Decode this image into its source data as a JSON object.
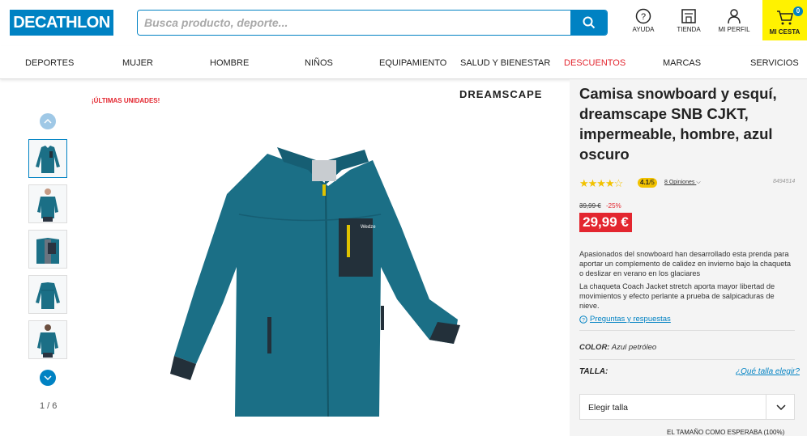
{
  "header": {
    "logo": "DECATHLON",
    "search_placeholder": "Busca producto, deporte...",
    "help": "AYUDA",
    "store": "TIENDA",
    "profile": "MI PERFIL",
    "cart": "MI CESTA",
    "cart_count": "0"
  },
  "nav": [
    {
      "label": "DEPORTES"
    },
    {
      "label": "MUJER"
    },
    {
      "label": "HOMBRE"
    },
    {
      "label": "NIÑOS"
    },
    {
      "label": "EQUIPAMIENTO"
    },
    {
      "label": "SALUD Y BIENESTAR"
    },
    {
      "label": "DESCUENTOS"
    },
    {
      "label": "MARCAS"
    },
    {
      "label": "SERVICIOS"
    }
  ],
  "gallery": {
    "pager": "1 / 6",
    "badge": "¡ÚLTIMAS UNIDADES!",
    "brand": "DREAMSCAPE"
  },
  "product": {
    "title": "Camisa snowboard y esquí, dreamscape SNB CJKT, impermeable, hombre, azul oscuro",
    "stars": "★★★★☆",
    "rating": "4.1",
    "rating_max": "/5",
    "reviews": "8 Opiniones",
    "sku": "8494514",
    "old_price": "39,99 €",
    "discount": "-25%",
    "price": "29,99 €",
    "desc1": "Apasionados del snowboard han desarrollado esta prenda para aportar un complemento de calidez en invierno bajo la chaqueta o deslizar en verano en los glaciares",
    "desc2": "La chaqueta Coach Jacket stretch aporta mayor libertad de movimientos y efecto perlante a prueba de salpicaduras de nieve.",
    "qa": "Preguntas y respuestas",
    "color_label": "COLOR:",
    "color_value": "Azul petróleo",
    "size_label": "TALLA:",
    "size_guide": "¿Qué talla elegir?",
    "size_select": "Elegir talla",
    "fit_note": "EL TAMAÑO COMO ESPERABA (100%)"
  },
  "colors": {
    "brand_blue": "#0082c3",
    "sale_red": "#e3262f",
    "cart_yellow": "#fff200",
    "jacket_teal": "#1b6f86"
  }
}
